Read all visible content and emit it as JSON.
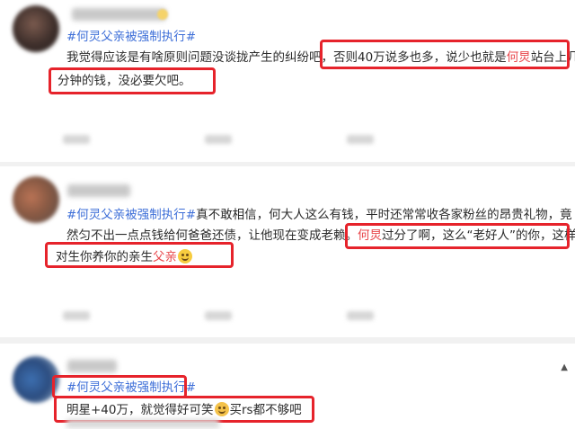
{
  "posts": [
    {
      "hashtag": "#何灵父亲被强制执行#",
      "line1": "我觉得应该是有啥原则问题没谈拢产生的纠纷吧，",
      "line1_boxed": "否则40万说多也多，说少也就是",
      "line1_name": "何炅",
      "line1_end": "站台上几",
      "line2": "分钟的钱，没必要欠吧。"
    },
    {
      "hashtag": "#何灵父亲被强制执行#",
      "line1_rest": "真不敢相信，何大人这么有钱，平时还常常收各家粉丝的昂贵礼物，竟",
      "line2_pre": "然匀不出一点点钱给何爸爸还债，让他现在变成老赖。",
      "line2_name": "何炅",
      "line2_boxed": "过分了啊，这么“老好人”的你，这样",
      "line3_pre": "对生你养你的亲生",
      "line3_hl": "父亲"
    },
    {
      "hashtag": "#何灵父亲被强制执行#",
      "line1_pre": "明星+40万，就觉得好可笑",
      "line1_post": "买rs都不够吧"
    }
  ],
  "colors": {
    "hashtag": "#3e6fd8",
    "highlight": "#e8484c",
    "box": "#e6232b"
  },
  "icons": [
    "smile-emoji-icon",
    "laugh-emoji-icon"
  ]
}
